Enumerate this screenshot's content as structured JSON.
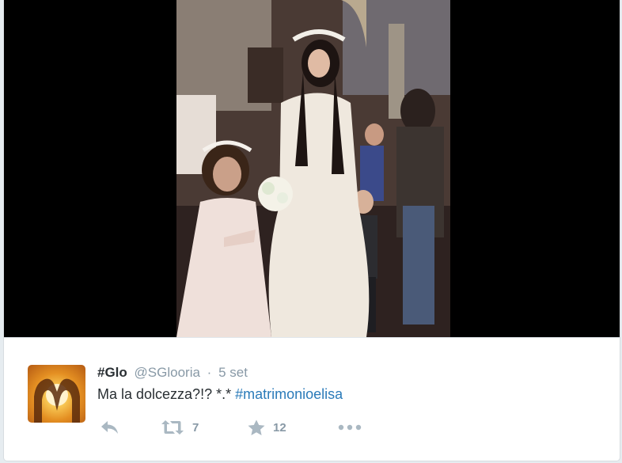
{
  "tweet": {
    "fullname": "#Glo",
    "username": "@SGlooria",
    "separator": "·",
    "timestamp": "5 set",
    "text": "Ma la dolcezza?!? *.* ",
    "hashtag": "#matrimonioelisa",
    "avatar_icon": "heart-hands-sunset-icon"
  },
  "actions": {
    "reply_icon": "reply-icon",
    "retweet_icon": "retweet-icon",
    "retweet_count": "7",
    "favorite_icon": "star-icon",
    "favorite_count": "12",
    "more_icon": "more-dots-icon"
  },
  "colors": {
    "hashtag": "#2b7bb9",
    "name": "#292f33",
    "meta": "#8899a6",
    "action_icon": "#aab8c2"
  }
}
